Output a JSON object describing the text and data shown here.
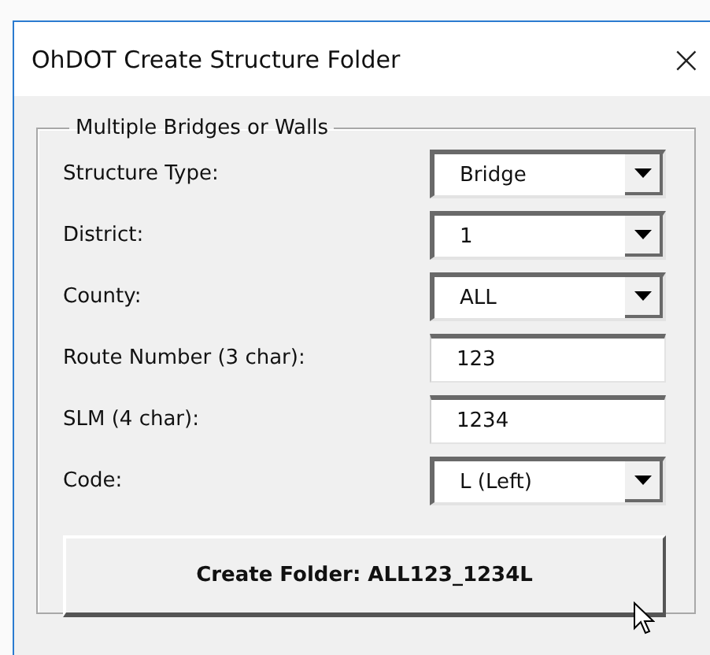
{
  "window": {
    "title": "OhDOT Create Structure Folder",
    "close": "×"
  },
  "frame": {
    "title": "Multiple Bridges or Walls"
  },
  "fields": [
    {
      "label": "Structure Type:",
      "kind": "dropdown",
      "value": "Bridge"
    },
    {
      "label": "District:",
      "kind": "dropdown",
      "value": "1"
    },
    {
      "label": "County:",
      "kind": "dropdown",
      "value": "ALL"
    },
    {
      "label": "Route Number (3 char):",
      "kind": "text",
      "value": "123"
    },
    {
      "label": "SLM (4 char):",
      "kind": "text",
      "value": "1234"
    },
    {
      "label": "Code:",
      "kind": "dropdown",
      "value": "L (Left)"
    }
  ],
  "button": {
    "label": "Create Folder: ALL123_1234L"
  }
}
